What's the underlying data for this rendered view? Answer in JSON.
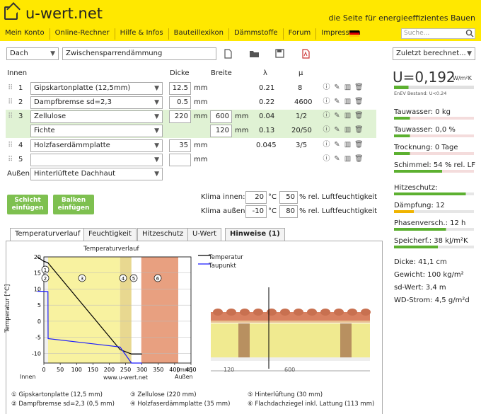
{
  "header": {
    "logo": "u-wert.net",
    "tagline": "die Seite für energieeffizientes Bauen",
    "nav": [
      "Mein Konto",
      "Online-Rechner",
      "Hilfe & Infos",
      "Bauteillexikon",
      "Dämmstoffe",
      "Forum",
      "Impressum"
    ],
    "search_placeholder": "Suche..."
  },
  "toolbar": {
    "type": "Dach",
    "name": "Zwischensparrendämmung",
    "recent": "Zuletzt berechnet..."
  },
  "table": {
    "col_innen": "Innen",
    "col_dicke": "Dicke",
    "col_breite": "Breite",
    "col_lambda": "λ",
    "col_mu": "μ",
    "unit_mm": "mm",
    "aussen": "Außen",
    "rows": [
      {
        "n": "1",
        "mat": "Gipskartonplatte (12,5mm)",
        "dicke": "12.5",
        "breite": "",
        "lambda": "0.21",
        "mu": "8"
      },
      {
        "n": "2",
        "mat": "Dampfbremse sd=2,3",
        "dicke": "0.5",
        "breite": "",
        "lambda": "0.22",
        "mu": "4600"
      },
      {
        "n": "3",
        "mat": "Zellulose",
        "dicke": "220",
        "breite": "600",
        "lambda": "0.04",
        "mu": "1/2"
      },
      {
        "n": "",
        "mat": "Fichte",
        "dicke": "",
        "breite": "120",
        "lambda": "0.13",
        "mu": "20/50"
      },
      {
        "n": "4",
        "mat": "Holzfaserdämmplatte",
        "dicke": "35",
        "breite": "",
        "lambda": "0.045",
        "mu": "3/5"
      },
      {
        "n": "5",
        "mat": "",
        "dicke": "",
        "breite": "",
        "lambda": "",
        "mu": ""
      }
    ],
    "aussen_mat": "Hinterlüftete Dachhaut"
  },
  "buttons": {
    "schicht": [
      "Schicht",
      "einfügen"
    ],
    "balken": [
      "Balken",
      "einfügen"
    ]
  },
  "klima": {
    "innen_label": "Klima innen:",
    "innen_temp": "20",
    "innen_rh": "50",
    "aussen_label": "Klima außen:",
    "aussen_temp": "-10",
    "aussen_rh": "80",
    "unit_c": "°C",
    "rh_label": "% rel. Luftfeuchtigkeit"
  },
  "tabs": [
    "Temperaturverlauf",
    "Feuchtigkeit",
    "Hitzeschutz",
    "U-Wert",
    "Hinweise (1)"
  ],
  "chart_data": {
    "type": "line",
    "title": "Temperaturverlauf",
    "ylabel": "Temperatur [°C]",
    "xlabel": "[mm]",
    "x_ticks": [
      "0",
      "50",
      "100",
      "150",
      "200",
      "250",
      "300",
      "350",
      "400",
      "450"
    ],
    "y_ticks": [
      "20",
      "15",
      "10",
      "5",
      "0",
      "-5",
      "-10"
    ],
    "xlim": [
      -20,
      450
    ],
    "ylim": [
      -13,
      20
    ],
    "label_innen": "Innen",
    "label_aussen": "Außen",
    "credit": "www.u-wert.net",
    "series": [
      {
        "name": "Temperatur",
        "color": "#000000",
        "x": [
          -20,
          0,
          12.5,
          13,
          233,
          268,
          300
        ],
        "y": [
          20,
          18.6,
          18.2,
          18.1,
          -8.8,
          -10.2,
          -10.2
        ]
      },
      {
        "name": "Taupunkt",
        "color": "#1a1aff",
        "x": [
          -20,
          0,
          12.5,
          13,
          233,
          268,
          300
        ],
        "y": [
          9.3,
          9.3,
          9.2,
          -5.4,
          -8.0,
          -13,
          -13
        ]
      }
    ],
    "layer_numbers": [
      "1",
      "2",
      "3",
      "4",
      "5",
      "6"
    ]
  },
  "legend": [
    {
      "n": "1",
      "text": "Gipskartonplatte (12,5 mm)"
    },
    {
      "n": "2",
      "text": "Dampfbremse sd=2,3 (0,5 mm)"
    },
    {
      "n": "3",
      "text": "Zellulose (220 mm)"
    },
    {
      "n": "4",
      "text": "Holzfaserdämmplatte (35 mm)"
    },
    {
      "n": "5",
      "text": "Hinterlüftung (30 mm)"
    },
    {
      "n": "6",
      "text": "Flachdachziegel inkl. Lattung (113 mm)"
    }
  ],
  "dims": {
    "left": "120",
    "right": "600"
  },
  "results": {
    "u_label": "U=0,192",
    "u_unit": "W/m²K",
    "enev": "EnEV Bestand: U<0.24",
    "items": [
      {
        "text": "Tauwasser: 0 kg",
        "fill": 0.0
      },
      {
        "text": "Tauwasser: 0,0 %",
        "fill": 0.0
      },
      {
        "text": "Trocknung: 0 Tage",
        "fill": 0.0
      },
      {
        "text": "Schimmel: 54 % rel. LF",
        "fill": 0.6
      }
    ],
    "items2": [
      {
        "text": "Hitzeschutz:",
        "fill": 0.9
      },
      {
        "text": "Dämpfung: 12",
        "fill": 0.25
      },
      {
        "text": "Phasenversch.: 12 h",
        "fill": 0.65
      },
      {
        "text": "Speicherf.: 38 kJ/m²K",
        "fill": 0.55
      }
    ],
    "stats": [
      "Dicke: 41,1 cm",
      "Gewicht: 100 kg/m²",
      "sd-Wert: 3,4 m",
      "WD-Strom: 4,5 g/m²d"
    ],
    "colors": {
      "good": "#5cb030",
      "warn": "#f0b400",
      "bad": "#e8a0a0"
    }
  }
}
